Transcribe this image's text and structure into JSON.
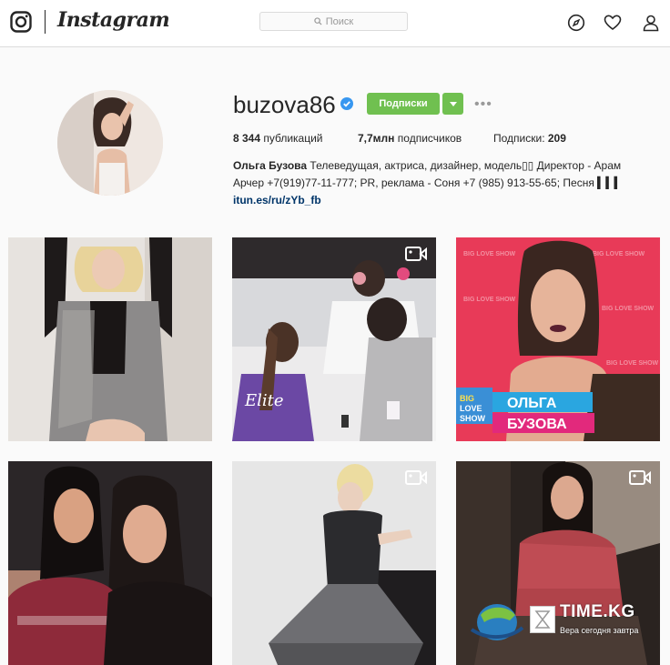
{
  "header": {
    "brand": "Instagram",
    "search_placeholder": "Поиск"
  },
  "profile": {
    "username": "buzova86",
    "follow_button": "Подписки",
    "more": "•••",
    "stats": {
      "posts_count": "8 344",
      "posts_label": "публикаций",
      "followers_count": "7,7млн",
      "followers_label": "подписчиков",
      "following_label": "Подписки:",
      "following_count": "209"
    },
    "bio_name": "Ольга Бузова",
    "bio_line1": "Телеведущая, актриса, дизайнер, модель▯▯ Директор - Арам",
    "bio_line2": "Арчер +7(919)77-11-777; PR, реклама - Соня +7 (985) 913-55-65; Песня ▍▍▍",
    "bio_link": "itun.es/ru/zYb_fb"
  },
  "posts": [
    {
      "id": "post-1",
      "video": false
    },
    {
      "id": "post-2",
      "video": true,
      "sign_text": "Elite"
    },
    {
      "id": "post-3",
      "video": false,
      "show_text": "BIG LOVE SHOW",
      "caption_line1": "ОЛЬГА",
      "caption_line2": "БУЗОВА",
      "badge_line1": "BIG",
      "badge_line2": "LOVE",
      "badge_line3": "SHOW"
    },
    {
      "id": "post-4",
      "video": false
    },
    {
      "id": "post-5",
      "video": true
    },
    {
      "id": "post-6",
      "video": true
    }
  ],
  "watermark": {
    "brand": "TIME.KG",
    "tagline": "Вера сегодня завтра"
  },
  "colors": {
    "accent_green": "#70c050",
    "verified_blue": "#3897f0",
    "link": "#003569"
  }
}
